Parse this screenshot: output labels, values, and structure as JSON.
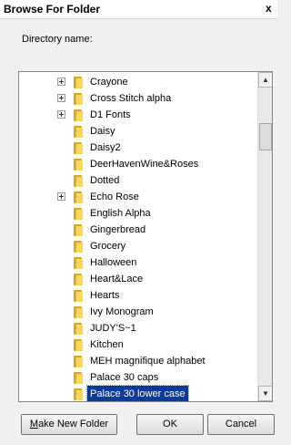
{
  "window": {
    "title": "Browse For Folder",
    "close_glyph": "x"
  },
  "directory_label": "Directory name:",
  "tree": {
    "items": [
      {
        "label": "Crayone",
        "has_children": true,
        "selected": false
      },
      {
        "label": "Cross Stitch alpha",
        "has_children": true,
        "selected": false
      },
      {
        "label": "D1 Fonts",
        "has_children": true,
        "selected": false
      },
      {
        "label": "Daisy",
        "has_children": false,
        "selected": false
      },
      {
        "label": "Daisy2",
        "has_children": false,
        "selected": false
      },
      {
        "label": "DeerHavenWine&Roses",
        "has_children": false,
        "selected": false
      },
      {
        "label": "Dotted",
        "has_children": false,
        "selected": false
      },
      {
        "label": "Echo Rose",
        "has_children": true,
        "selected": false
      },
      {
        "label": "English Alpha",
        "has_children": false,
        "selected": false
      },
      {
        "label": "Gingerbread",
        "has_children": false,
        "selected": false
      },
      {
        "label": "Grocery",
        "has_children": false,
        "selected": false
      },
      {
        "label": "Halloween",
        "has_children": false,
        "selected": false
      },
      {
        "label": "Heart&Lace",
        "has_children": false,
        "selected": false
      },
      {
        "label": "Hearts",
        "has_children": false,
        "selected": false
      },
      {
        "label": "Ivy Monogram",
        "has_children": false,
        "selected": false
      },
      {
        "label": "JUDY'S~1",
        "has_children": false,
        "selected": false
      },
      {
        "label": "Kitchen",
        "has_children": false,
        "selected": false
      },
      {
        "label": "MEH magnifique alphabet",
        "has_children": false,
        "selected": false
      },
      {
        "label": "Palace 30 caps",
        "has_children": false,
        "selected": false
      },
      {
        "label": "Palace 30 lower case",
        "has_children": false,
        "selected": true
      }
    ]
  },
  "scrollbar": {
    "up_arrow": "▲",
    "down_arrow": "▼",
    "position": 0.12
  },
  "buttons": {
    "new_folder": "Make New Folder",
    "ok": "OK",
    "cancel": "Cancel"
  },
  "colors": {
    "selection": "#0a3a9a",
    "folder": "#f6d66a",
    "background": "#f0f0f0"
  }
}
